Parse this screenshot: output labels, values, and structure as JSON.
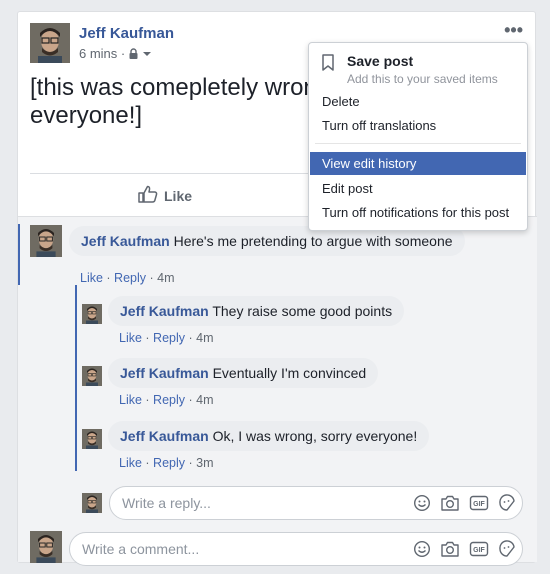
{
  "post": {
    "author": "Jeff Kaufman",
    "time": "6 mins ·",
    "text_line1": "[this was comepletely wron",
    "text_line2": "everyone!]",
    "like_label": "Like",
    "more_label": "•••"
  },
  "menu": {
    "save_title": "Save post",
    "save_subtitle": "Add this to your saved items",
    "items": [
      {
        "label": "Delete"
      },
      {
        "label": "Turn off translations"
      },
      {
        "label": "View edit history"
      },
      {
        "label": "Edit post"
      },
      {
        "label": "Turn off notifications for this post"
      }
    ]
  },
  "comments": [
    {
      "author": "Jeff Kaufman",
      "text": " Here's me pretending to argue with someone",
      "like": "Like",
      "reply": "Reply",
      "time": "4m"
    },
    {
      "author": "Jeff Kaufman",
      "text": " They raise some good points",
      "like": "Like",
      "reply": "Reply",
      "time": "4m"
    },
    {
      "author": "Jeff Kaufman",
      "text": " Eventually I'm convinced",
      "like": "Like",
      "reply": "Reply",
      "time": "4m"
    },
    {
      "author": "Jeff Kaufman",
      "text": " Ok, I was wrong, sorry everyone!",
      "like": "Like",
      "reply": "Reply",
      "time": "3m"
    }
  ],
  "reply_input": {
    "placeholder": "Write a reply..."
  },
  "comment_input": {
    "placeholder": "Write a comment..."
  },
  "colors": {
    "link": "#385898",
    "accent": "#4267b2",
    "menu_highlight": "#4267b2"
  },
  "icons": [
    "avatar",
    "lock-icon",
    "caret-down-icon",
    "more-icon",
    "bookmark-icon",
    "thumbs-up-icon",
    "emoji-icon",
    "camera-icon",
    "gif-icon",
    "sticker-icon"
  ]
}
